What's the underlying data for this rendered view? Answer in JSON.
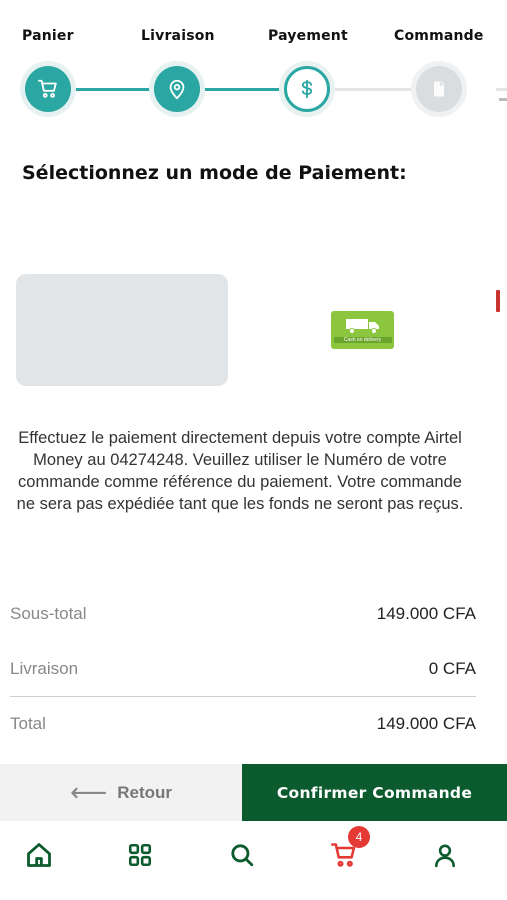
{
  "stepper": {
    "steps": [
      {
        "label": "Panier",
        "icon": "cart-icon",
        "state": "done"
      },
      {
        "label": "Livraison",
        "icon": "location-pin-icon",
        "state": "done"
      },
      {
        "label": "Payement",
        "icon": "dollar-icon",
        "state": "current"
      },
      {
        "label": "Commande",
        "icon": "order-icon",
        "state": "pending"
      }
    ]
  },
  "heading": "Sélectionnez un mode de Paiement:",
  "payment_options": [
    {
      "name": "airtel-money-card",
      "selected": true
    },
    {
      "name": "cash-on-delivery",
      "logo_text": "Cash on delivery"
    }
  ],
  "description": "Effectuez le paiement directement depuis votre compte Airtel Money au 04274248. Veuillez utiliser le Numéro de votre commande comme référence du paiement. Votre commande ne sera pas expédiée tant que les fonds ne seront pas reçus.",
  "summary": {
    "subtotal_label": "Sous-total",
    "subtotal_value": "149.000 CFA",
    "delivery_label": "Livraison",
    "delivery_value": "0 CFA",
    "total_label": "Total",
    "total_value": "149.000 CFA"
  },
  "actions": {
    "back_label": "Retour",
    "confirm_label": "Confirmer Commande"
  },
  "bottom_nav": {
    "items": [
      "home-icon",
      "grid-icon",
      "search-icon",
      "cart-icon",
      "user-icon"
    ],
    "cart_badge": "4"
  },
  "colors": {
    "teal": "#2aa7a2",
    "brand_green": "#0c5b2e",
    "badge_red": "#e53935",
    "cod_green": "#8cc63f"
  }
}
